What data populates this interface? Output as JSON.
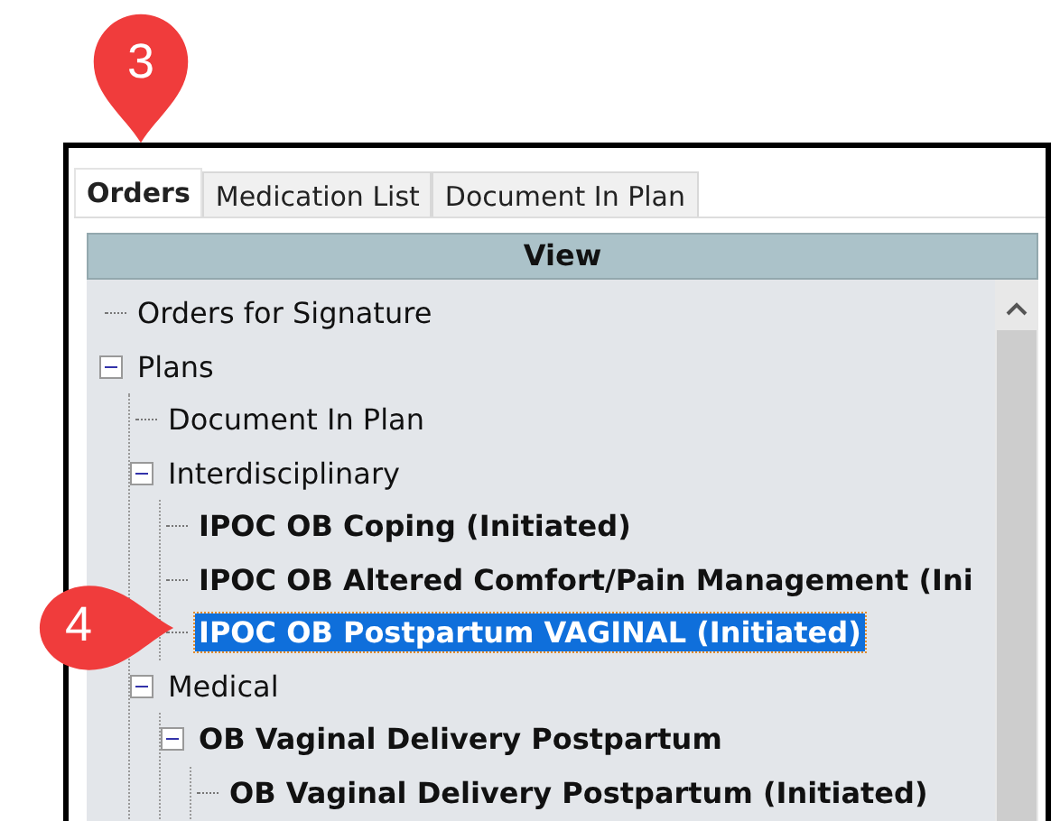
{
  "callouts": [
    {
      "number": "3",
      "kind": "down"
    },
    {
      "number": "4",
      "kind": "right"
    }
  ],
  "tabs": [
    {
      "label": "Orders",
      "selected": true
    },
    {
      "label": "Medication List",
      "selected": false
    },
    {
      "label": "Document In Plan",
      "selected": false
    }
  ],
  "view_header": "View",
  "tree": [
    {
      "label": "Orders for Signature",
      "kind": "folder",
      "selected": false
    },
    {
      "label": "Plans",
      "kind": "folder",
      "selected": false,
      "expanded": true,
      "children": [
        {
          "label": "Document In Plan",
          "kind": "folder",
          "selected": false
        },
        {
          "label": "Interdisciplinary",
          "kind": "folder",
          "selected": false,
          "expanded": true,
          "children": [
            {
              "label": "IPOC OB Coping (Initiated)",
              "kind": "plan",
              "selected": false
            },
            {
              "label": "IPOC OB Altered Comfort/Pain Management (Ini",
              "kind": "plan",
              "selected": false
            },
            {
              "label": "IPOC OB Postpartum VAGINAL (Initiated)",
              "kind": "plan",
              "selected": true
            }
          ]
        },
        {
          "label": "Medical",
          "kind": "folder",
          "selected": false,
          "expanded": true,
          "children": [
            {
              "label": "OB Vaginal Delivery Postpartum",
              "kind": "plan",
              "selected": false,
              "expanded": true,
              "children": [
                {
                  "label": "OB Vaginal Delivery Postpartum (Initiated)",
                  "kind": "plan",
                  "selected": false
                }
              ]
            }
          ]
        }
      ]
    }
  ]
}
